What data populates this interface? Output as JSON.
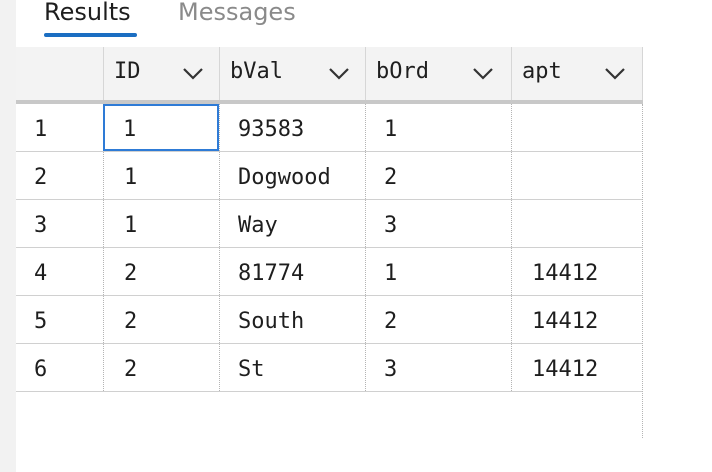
{
  "tabs": [
    {
      "label": "Results",
      "active": true
    },
    {
      "label": "Messages",
      "active": false
    }
  ],
  "columns": [
    {
      "label": "ID"
    },
    {
      "label": "bVal"
    },
    {
      "label": "bOrd"
    },
    {
      "label": "apt"
    }
  ],
  "rows": [
    {
      "num": "1",
      "cells": [
        "1",
        "93583",
        "1",
        ""
      ]
    },
    {
      "num": "2",
      "cells": [
        "1",
        "Dogwood",
        "2",
        ""
      ]
    },
    {
      "num": "3",
      "cells": [
        "1",
        "Way",
        "3",
        ""
      ]
    },
    {
      "num": "4",
      "cells": [
        "2",
        "81774",
        "1",
        "14412"
      ]
    },
    {
      "num": "5",
      "cells": [
        "2",
        "South",
        "2",
        "14412"
      ]
    },
    {
      "num": "6",
      "cells": [
        "2",
        "St",
        "3",
        "14412"
      ]
    }
  ],
  "selected_cell": {
    "row": 0,
    "col": 0
  },
  "colors": {
    "accent": "#1b6ec2",
    "selection": "#2e7bd6"
  },
  "icons": {
    "column_menu": "chevron-down-icon"
  }
}
